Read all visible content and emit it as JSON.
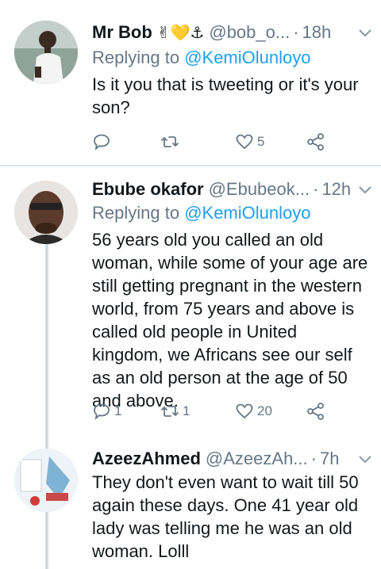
{
  "tweets": [
    {
      "name": "Mr Bob",
      "emojis": "✌💛⚓",
      "handle": "@bob_o...",
      "time": "18h",
      "replying_prefix": "Replying to ",
      "replying_to": "@KemiOlunloyo",
      "text": "Is it you that is tweeting or it's your son?",
      "reply_count": "",
      "retweet_count": "",
      "like_count": "5"
    },
    {
      "name": "Ebube okafor",
      "handle": "@Ebubeok...",
      "time": "12h",
      "replying_prefix": "Replying to ",
      "replying_to": "@KemiOlunloyo",
      "text": "56 years old you called an old woman, while some of your age are still getting pregnant in the western world, from 75 years and above is called old people in United kingdom, we Africans see our self as an old person at the age of 50 and above.",
      "reply_count": "1",
      "retweet_count": "1",
      "like_count": "20"
    },
    {
      "name": "AzeezAhmed",
      "handle": "@AzeezAh...",
      "time": "7h",
      "text": "They don't even want to wait till 50 again these days. One 41 year old lady was telling me he was an old woman. Lolll"
    }
  ],
  "separator": "·",
  "icons": {
    "reply": "reply-icon",
    "retweet": "retweet-icon",
    "like": "heart-icon",
    "share": "share-icon",
    "menu": "chevron-down-icon"
  },
  "colors": {
    "link": "#1da1f2",
    "muted": "#657786",
    "text": "#14171a",
    "thread_line": "#d4dbe0"
  }
}
